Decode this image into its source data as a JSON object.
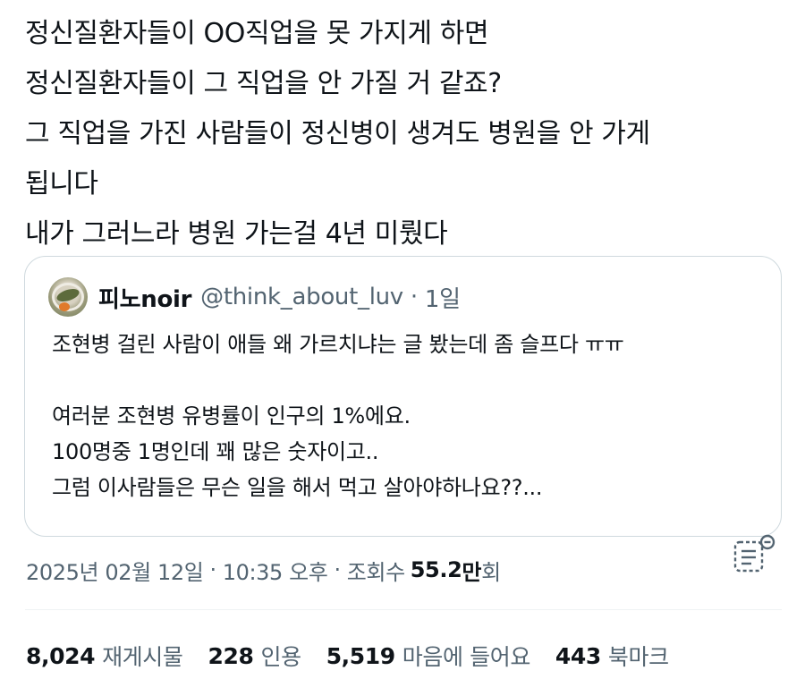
{
  "tweet": {
    "lines": [
      "정신질환자들이 OO직업을 못 가지게 하면",
      "정신질환자들이 그 직업을 안 가질 거 같죠?",
      "그 직업을 가진 사람들이 정신병이 생겨도 병원을 안 가게",
      "됩니다",
      "내가 그러느라 병원 가는걸 4년 미뤘다"
    ]
  },
  "quote": {
    "name": "피노noir",
    "handle": "@think_about_luv",
    "dot": "·",
    "time": "1일",
    "line1": "조현병 걸린 사람이 애들 왜 가르치냐는 글 봤는데 좀 슬프다 ㅠㅠ",
    "line2": "여러분 조현병 유병률이 인구의 1%에요.",
    "line3": "100명중 1명인데 꽤 많은 숫자이고..",
    "line4": "그럼 이사람들은 무슨 일을 해서 먹고 살아야하나요??..."
  },
  "meta": {
    "date": "2025년 02월 12일",
    "time": "10:35 오후",
    "dot": "·",
    "views_label": "조회수",
    "views_value": "55.2",
    "views_unit_bold": "만",
    "views_unit": "회"
  },
  "icons": {
    "analytics": "analytics-icon",
    "avatar": "avatar"
  },
  "stats": [
    {
      "count": "8,024",
      "label": "재게시물"
    },
    {
      "count": "228",
      "label": "인용"
    },
    {
      "count": "5,519",
      "label": "마음에 들어요"
    },
    {
      "count": "443",
      "label": "북마크"
    }
  ],
  "colors": {
    "text_primary": "#0f1419",
    "text_secondary": "#536471",
    "border": "#cfd9de"
  }
}
